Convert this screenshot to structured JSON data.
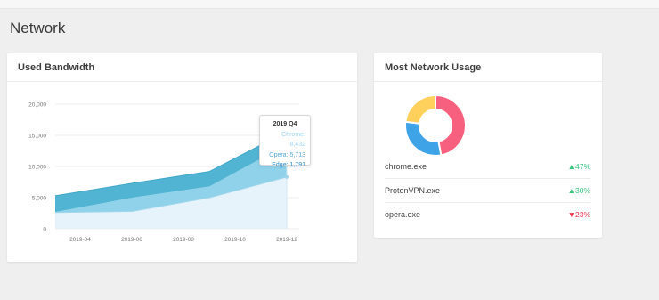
{
  "page": {
    "title": "Network"
  },
  "bandwidth_card": {
    "title": "Used Bandwidth"
  },
  "tooltip": {
    "title": "2019 Q4",
    "lines": [
      "Chrome: 8,432",
      "Opera: 5,713",
      "Edge: 1,791"
    ]
  },
  "usage_card": {
    "title": "Most Network Usage",
    "processes": [
      {
        "name": "chrome.exe",
        "change": "47%",
        "direction": "up"
      },
      {
        "name": "ProtonVPN.exe",
        "change": "30%",
        "direction": "up"
      },
      {
        "name": "opera.exe",
        "change": "23%",
        "direction": "down"
      }
    ]
  },
  "chart_data": [
    {
      "type": "area",
      "x": [
        "2019-03",
        "2019-06",
        "2019-09",
        "2019-12"
      ],
      "tick_labels": [
        "2019-04",
        "2019-06",
        "2019-08",
        "2019-10",
        "2019-12"
      ],
      "y_ticks": [
        "20,000",
        "15,000",
        "10,000",
        "5,000",
        "0"
      ],
      "ylim": [
        0,
        20000
      ],
      "stacked": true,
      "series": [
        {
          "name": "Edge",
          "values": [
            2600,
            2800,
            5000,
            8300
          ],
          "color": "#e6f3fb"
        },
        {
          "name": "Opera",
          "values": [
            2700,
            5000,
            6800,
            13500
          ],
          "color": "#8fd2ea"
        },
        {
          "name": "Chrome",
          "values": [
            5300,
            7300,
            9200,
            15600
          ],
          "color": "#52b4d3"
        }
      ]
    },
    {
      "type": "pie",
      "donut": true,
      "labels": [
        "chrome.exe",
        "ProtonVPN.exe",
        "opera.exe"
      ],
      "values": [
        47,
        30,
        23
      ],
      "colors": [
        "#f7617f",
        "#3fa3e7",
        "#ffd05c"
      ]
    }
  ]
}
